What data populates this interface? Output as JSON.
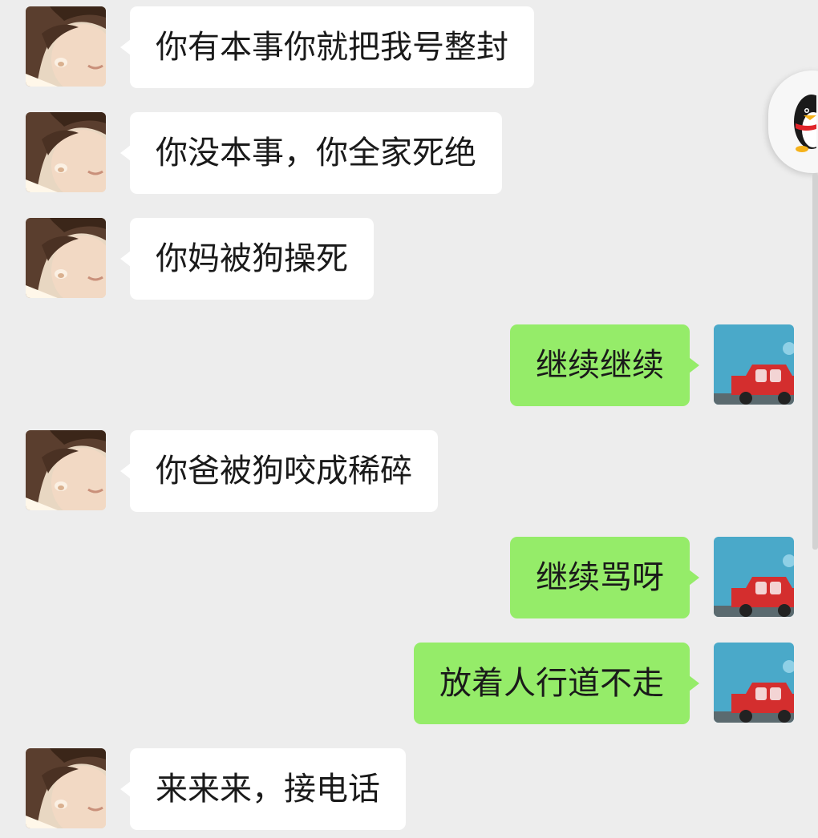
{
  "colors": {
    "background": "#ededed",
    "incoming_bubble": "#ffffff",
    "outgoing_bubble": "#95ec69"
  },
  "icons": {
    "contact_avatar": "sleeping-person-avatar",
    "self_avatar": "red-car-avatar",
    "floating_widget": "penguin-icon"
  },
  "messages": [
    {
      "sender": "contact",
      "text": "你有本事你就把我号整封"
    },
    {
      "sender": "contact",
      "text": "你没本事，你全家死绝"
    },
    {
      "sender": "contact",
      "text": "你妈被狗操死"
    },
    {
      "sender": "self",
      "text": "继续继续"
    },
    {
      "sender": "contact",
      "text": "你爸被狗咬成稀碎"
    },
    {
      "sender": "self",
      "text": "继续骂呀"
    },
    {
      "sender": "self",
      "text": "放着人行道不走"
    },
    {
      "sender": "contact",
      "text": "来来来，接电话"
    }
  ]
}
